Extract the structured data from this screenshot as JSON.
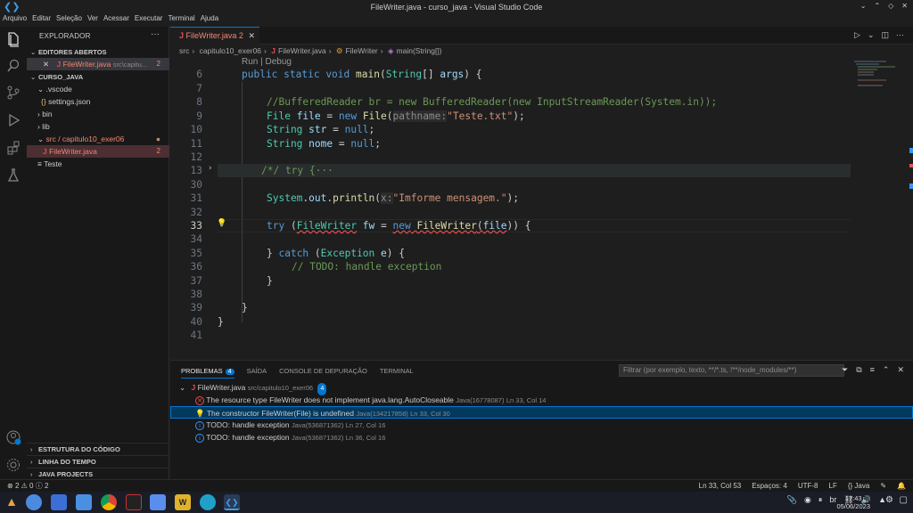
{
  "window": {
    "title": "FileWriter.java - curso_java - Visual Studio Code"
  },
  "menu": [
    "Arquivo",
    "Editar",
    "Seleção",
    "Ver",
    "Acessar",
    "Executar",
    "Terminal",
    "Ajuda"
  ],
  "sidebar": {
    "title": "EXPLORADOR",
    "open_editors_label": "EDITORES ABERTOS",
    "open_editor": {
      "name": "FileWriter.java",
      "path": "src\\capitu...",
      "badge": "2"
    },
    "project_label": "CURSO_JAVA",
    "tree": [
      {
        "name": ".vscode"
      },
      {
        "name": "settings.json"
      },
      {
        "name": "bin"
      },
      {
        "name": "lib"
      },
      {
        "name": "src / capitulo10_exer06"
      },
      {
        "name": "FileWriter.java",
        "badge": "2"
      },
      {
        "name": "Teste"
      }
    ],
    "bottom_sections": [
      "ESTRUTURA DO CÓDIGO",
      "LINHA DO TEMPO",
      "JAVA PROJECTS"
    ]
  },
  "editor": {
    "tab_label": "FileWriter.java 2",
    "breadcrumb": [
      "src",
      "capitulo10_exer06",
      "FileWriter.java",
      "FileWriter",
      "main(String[])"
    ],
    "codelens": "Run | Debug",
    "line_numbers": [
      "6",
      "7",
      "8",
      "9",
      "10",
      "11",
      "12",
      "13",
      "30",
      "31",
      "32",
      "33",
      "34",
      "35",
      "36",
      "37",
      "38",
      "39",
      "40",
      "41"
    ],
    "lines": {
      "l6": [
        "public",
        " static",
        " void",
        " main",
        "(",
        "String",
        "[] ",
        "args",
        ") {"
      ],
      "l8": "//BufferedReader br = new BufferedReader(new InputStreamReader(System.in));",
      "l9": [
        "File",
        " file",
        " = ",
        "new",
        " File",
        "(",
        "pathname:",
        "\"Teste.txt\"",
        ");"
      ],
      "l10": [
        "String",
        " str",
        " = ",
        "null",
        ";"
      ],
      "l11": [
        "String",
        " nome",
        " = ",
        "null",
        ";"
      ],
      "l13": "/*/ try {···",
      "l31": [
        "System",
        ".",
        "out",
        ".",
        "println",
        "(",
        "x:",
        "\"Imforme mensagem.\"",
        ");"
      ],
      "l33": [
        "try",
        " (",
        "FileWriter",
        " fw",
        " = ",
        "new",
        " FileWriter",
        "(",
        "file",
        ")) {"
      ],
      "l35": [
        "} ",
        "catch",
        " (",
        "Exception",
        " e",
        ") {"
      ],
      "l36": "// TODO: handle exception",
      "l37": "}",
      "l39": "}",
      "l40": "}"
    }
  },
  "panel": {
    "tabs": [
      "PROBLEMAS",
      "SAÍDA",
      "CONSOLE DE DEPURAÇÃO",
      "TERMINAL"
    ],
    "problems_count": "4",
    "filter_placeholder": "Filtrar (por exemplo, texto, **/*.ts, !**/node_modules/**)",
    "file": {
      "name": "FileWriter.java",
      "path": "src/capitulo10_exer06",
      "count": "4"
    },
    "problems": [
      {
        "text": "The resource type FileWriter does not implement java.lang.AutoCloseable",
        "code": "Java(16778087)",
        "pos": "Ln 33, Col 14"
      },
      {
        "text": "The constructor FileWriter(File) is undefined",
        "code": "Java(134217858)",
        "pos": "Ln 33, Col 30"
      },
      {
        "text": "TODO: handle exception",
        "code": "Java(536871362)",
        "pos": "Ln 27, Col 16"
      },
      {
        "text": "TODO: handle exception",
        "code": "Java(536871362)",
        "pos": "Ln 36, Col 16"
      }
    ]
  },
  "status": {
    "errors": "2",
    "warnings": "0",
    "info": "2",
    "position": "Ln 33, Col 53",
    "spaces": "Espaços: 4",
    "encoding": "UTF-8",
    "eol": "LF",
    "language": "Java"
  },
  "taskbar": {
    "time": "17:43",
    "date": "05/06/2023",
    "lang": "br"
  },
  "colors": {
    "accent": "#0078d4",
    "error": "#f14c4c",
    "keyword": "#569cd6",
    "type": "#4ec9b0",
    "string": "#ce9178",
    "comment": "#6a9955"
  }
}
